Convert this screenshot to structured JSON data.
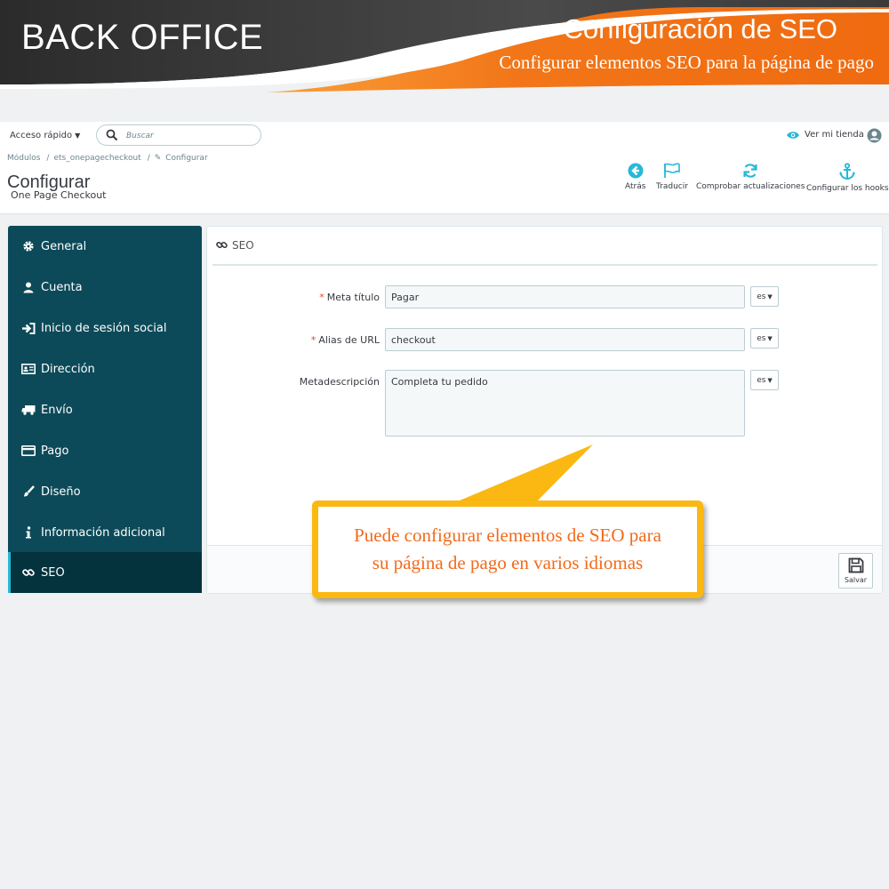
{
  "banner": {
    "left_title": "BACK OFFICE",
    "right_title": "Configuración de SEO",
    "right_subtitle": "Configurar elementos SEO para la página de pago",
    "colors": {
      "dark": "#3a3a3a",
      "orange": "#f27618"
    }
  },
  "topbar": {
    "quick_access": "Acceso rápido",
    "search_placeholder": "Buscar",
    "view_shop": "Ver mi tienda"
  },
  "breadcrumb": [
    "Módulos",
    "ets_onepagecheckout",
    "Configurar"
  ],
  "page": {
    "title": "Configurar",
    "subtitle": "One Page Checkout"
  },
  "toolbar": {
    "back": "Atrás",
    "translate": "Traducir",
    "check_updates": "Comprobar actualizaciones",
    "hooks": "Configurar los hooks"
  },
  "sidebar": {
    "items": [
      {
        "label": "General",
        "icon": "gear-icon"
      },
      {
        "label": "Cuenta",
        "icon": "user-icon"
      },
      {
        "label": "Inicio de sesión social",
        "icon": "sign-in-icon"
      },
      {
        "label": "Dirección",
        "icon": "address-card-icon"
      },
      {
        "label": "Envío",
        "icon": "truck-icon"
      },
      {
        "label": "Pago",
        "icon": "credit-card-icon"
      },
      {
        "label": "Diseño",
        "icon": "brush-icon"
      },
      {
        "label": "Información adicional",
        "icon": "info-icon"
      },
      {
        "label": "SEO",
        "icon": "link-icon",
        "active": true
      }
    ]
  },
  "panel": {
    "title": "SEO",
    "fields": {
      "meta_title": {
        "label": "Meta título",
        "value": "Pagar",
        "required": true,
        "lang": "es"
      },
      "url_alias": {
        "label": "Alias de URL",
        "value": "checkout",
        "required": true,
        "lang": "es"
      },
      "meta_description": {
        "label": "Metadescripción",
        "value": "Completa tu pedido",
        "required": false,
        "lang": "es"
      }
    },
    "save_label": "Salvar"
  },
  "callout": {
    "line1": "Puede configurar elementos de SEO para",
    "line2": "su página de pago en varios idiomas",
    "colors": {
      "border": "#fbb813",
      "text": "#f26a1b"
    }
  },
  "colors": {
    "sidebar_bg": "#0c4a59",
    "sidebar_active": "#04323d",
    "accent": "#25b9d7"
  }
}
